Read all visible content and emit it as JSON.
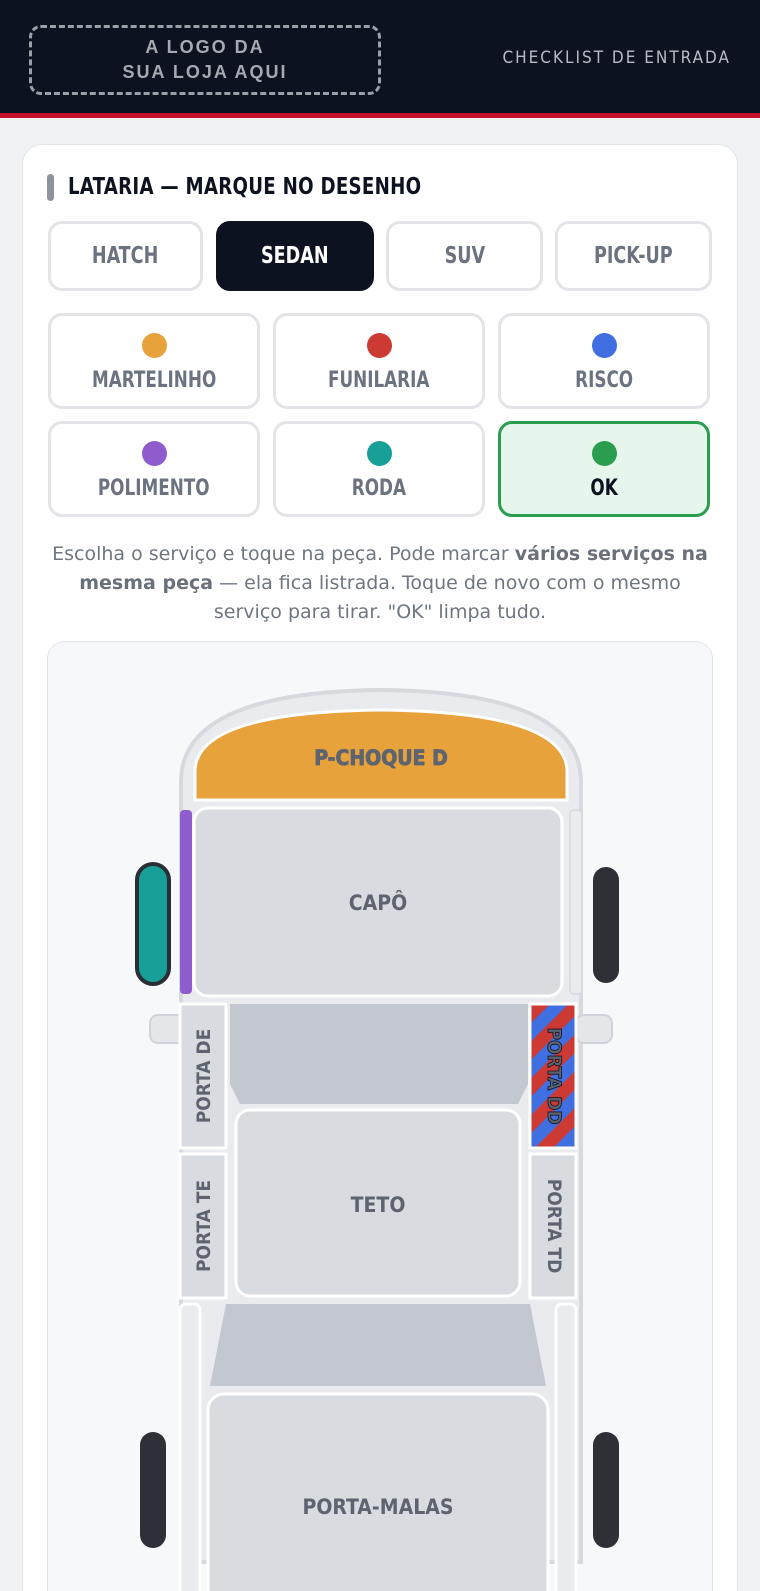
{
  "header": {
    "logo_placeholder": "A LOGO DA\nSUA LOJA AQUI",
    "title": "CHECKLIST DE ENTRADA"
  },
  "section": {
    "title": "LATARIA — MARQUE NO DESENHO"
  },
  "vehicle_types": [
    {
      "label": "HATCH",
      "active": false
    },
    {
      "label": "SEDAN",
      "active": true
    },
    {
      "label": "SUV",
      "active": false
    },
    {
      "label": "PICK-UP",
      "active": false
    }
  ],
  "services": [
    {
      "label": "MARTELINHO",
      "color": "#e8a23c",
      "icon": "orange-dot-icon"
    },
    {
      "label": "FUNILARIA",
      "color": "#cc3a33",
      "icon": "red-dot-icon"
    },
    {
      "label": "RISCO",
      "color": "#3f6fe0",
      "icon": "blue-dot-icon"
    },
    {
      "label": "POLIMENTO",
      "color": "#8e5ccc",
      "icon": "purple-dot-icon"
    },
    {
      "label": "RODA",
      "color": "#17a097",
      "icon": "teal-dot-icon"
    },
    {
      "label": "OK",
      "color": "#2a9d4f",
      "icon": "green-dot-icon",
      "selected": true
    }
  ],
  "help": {
    "part1": "Escolha o serviço e toque na peça. Pode marcar ",
    "bold": "vários serviços na mesma peça",
    "part2": " — ela fica listrada. Toque de novo com o mesmo serviço para tirar. \"OK\" limpa tudo."
  },
  "car_parts": {
    "bumper_front": "P-CHOQUE D",
    "hood": "CAPÔ",
    "door_front_left": "PORTA DE",
    "door_front_right": "PORTA DD",
    "door_rear_left": "PORTA TE",
    "door_rear_right": "PORTA TD",
    "roof": "TETO",
    "trunk": "PORTA-MALAS"
  },
  "colors": {
    "navy": "#0c1220",
    "accent_red": "#c8102e",
    "part_fill": "#d8dbe0",
    "glass_fill": "#c2c7d0"
  }
}
